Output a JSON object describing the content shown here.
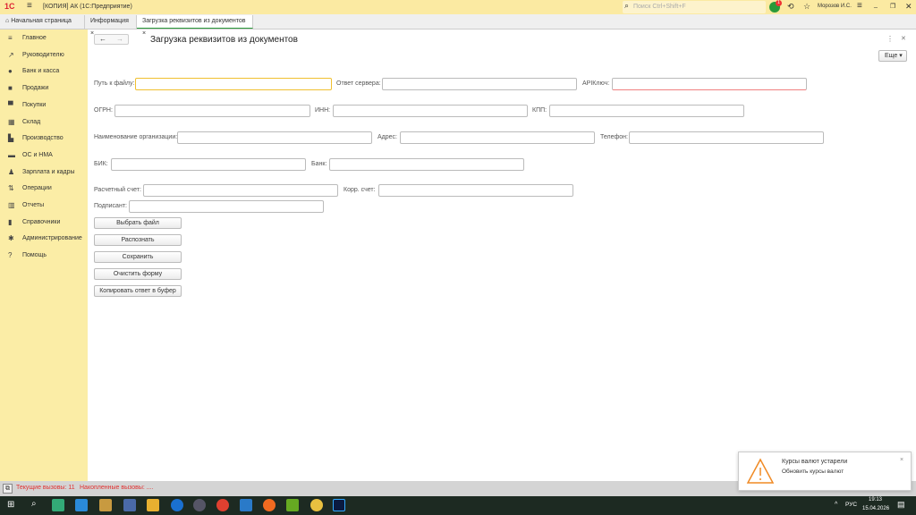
{
  "app": {
    "title": "[КОПИЯ] АК  (1С:Предприятие)",
    "search_placeholder": "Поиск Ctrl+Shift+F",
    "user": "Морозов И.С.",
    "notif_count": "1"
  },
  "tabs": [
    {
      "label": "Начальная страница"
    },
    {
      "label": "Информация"
    },
    {
      "label": "Загрузка реквизитов из документов"
    }
  ],
  "sidebar": {
    "items": [
      {
        "label": "Главное",
        "icon": "menu-icon"
      },
      {
        "label": "Руководителю",
        "icon": "trend-icon"
      },
      {
        "label": "Банк и касса",
        "icon": "coin-icon"
      },
      {
        "label": "Продажи",
        "icon": "bag-icon"
      },
      {
        "label": "Покупки",
        "icon": "cart-icon"
      },
      {
        "label": "Склад",
        "icon": "warehouse-icon"
      },
      {
        "label": "Производство",
        "icon": "factory-icon"
      },
      {
        "label": "ОС и НМА",
        "icon": "truck-icon"
      },
      {
        "label": "Зарплата и кадры",
        "icon": "person-icon"
      },
      {
        "label": "Операции",
        "icon": "operations-icon"
      },
      {
        "label": "Отчеты",
        "icon": "chart-icon"
      },
      {
        "label": "Справочники",
        "icon": "book-icon"
      },
      {
        "label": "Администрирование",
        "icon": "gear-icon"
      },
      {
        "label": "Помощь",
        "icon": "help-icon"
      }
    ]
  },
  "form": {
    "title": "Загрузка реквизитов из документов",
    "more": "Еще",
    "fields": {
      "path": "Путь к файлу:",
      "server": "Ответ сервера:",
      "apikey": "APIКлюч:",
      "ogrn": "ОГРН:",
      "inn": "ИНН:",
      "kpp": "КПП:",
      "org": "Наименование организации:",
      "addr": "Адрес:",
      "phone": "Телефон:",
      "bik": "БИК:",
      "bank": "Банк:",
      "account": "Расчетный счет:",
      "corr": "Корр. счет:",
      "signer": "Подписант:"
    },
    "buttons": [
      "Выбрать файл",
      "Распознать",
      "Сохранить",
      "Очистить форму",
      "Копировать ответ в буфер"
    ]
  },
  "status": {
    "current": "Текущие вызовы: 11",
    "accum": "Накопленные вызовы: ...."
  },
  "notification": {
    "title": "Курсы валют устарели",
    "text": "Обновить курсы валют"
  },
  "tray": {
    "lang": "РУС",
    "time": "19:13",
    "date": "15.04.2026"
  },
  "colors": {
    "accent": "#2a9a3a",
    "focus": "#f0c030",
    "error": "#f08080",
    "status_text": "#e03030"
  }
}
